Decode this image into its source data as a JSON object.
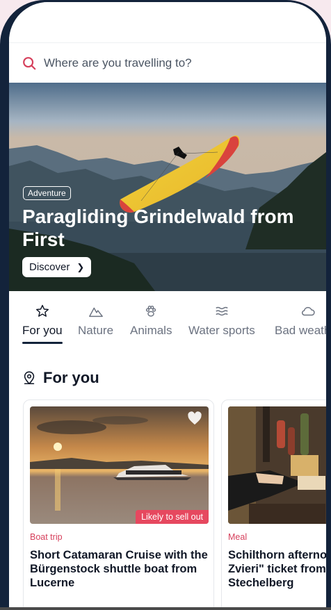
{
  "search": {
    "placeholder": "Where are you travelling to?"
  },
  "hero": {
    "tag": "Adventure",
    "title": "Paragliding Grindelwald from First",
    "button_label": "Discover"
  },
  "categories": [
    {
      "label": "For you",
      "icon": "star-icon",
      "active": true
    },
    {
      "label": "Nature",
      "icon": "mountain-icon",
      "active": false
    },
    {
      "label": "Animals",
      "icon": "paw-icon",
      "active": false
    },
    {
      "label": "Water sports",
      "icon": "waves-icon",
      "active": false
    },
    {
      "label": "Bad weather",
      "icon": "cloud-icon",
      "active": false
    }
  ],
  "section": {
    "title": "For you",
    "icon": "location-pin-icon"
  },
  "cards": [
    {
      "category": "Boat trip",
      "title": "Short Catamaran Cruise with the Bürgenstock shuttle boat from Lucerne",
      "badge": "Likely to sell out"
    },
    {
      "category": "Meal",
      "title": "Schilthorn afternoon \"Piz Gloria Zvieri\" ticket from Mürren Stechelberg"
    }
  ],
  "colors": {
    "accent": "#d6405c",
    "frame": "#13233b",
    "badge": "#e6485f"
  }
}
